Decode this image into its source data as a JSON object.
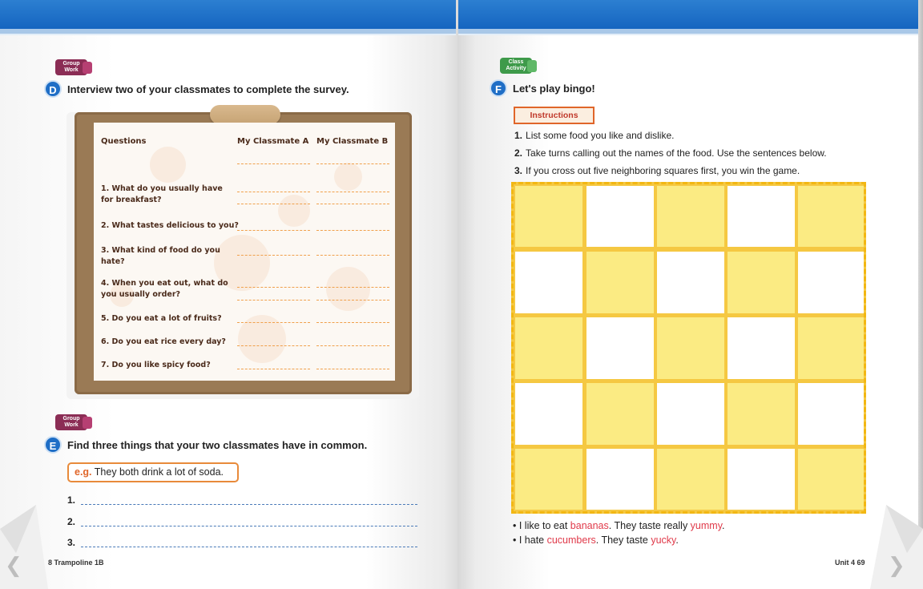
{
  "left_page": {
    "section_d": {
      "badge": "Group\nWork",
      "letter": "D",
      "title": "Interview two of your classmates to complete the survey.",
      "table": {
        "col_questions": "Questions",
        "col_a": "My Classmate A",
        "col_b": "My Classmate B",
        "questions": [
          "1. What do you usually have for breakfast?",
          "2. What tastes delicious to you?",
          "3. What kind of food do you hate?",
          "4. When you eat out, what do you usually order?",
          "5. Do you eat a lot of fruits?",
          "6. Do you eat rice every day?",
          "7. Do you like spicy food?"
        ]
      }
    },
    "section_e": {
      "badge": "Group\nWork",
      "letter": "E",
      "title": "Find three things that your two classmates have in common.",
      "example_prefix": "e.g.",
      "example_text": "They both drink a lot of soda.",
      "lines": [
        "1.",
        "2.",
        "3."
      ]
    },
    "footer": "8 Trampoline 1B"
  },
  "right_page": {
    "section_f": {
      "badge": "Class\nActivity",
      "letter": "F",
      "title": "Let's play bingo!",
      "instructions_label": "Instructions",
      "instructions": [
        {
          "n": "1.",
          "text": "List some food you like and dislike."
        },
        {
          "n": "2.",
          "text": "Take turns calling out the names of the food. Use the sentences below."
        },
        {
          "n": "3.",
          "text": "If you cross out five neighboring squares first, you win the game."
        }
      ],
      "sentences": [
        {
          "pre": "I like to eat ",
          "food": "bananas",
          "mid": ". They taste really ",
          "taste": "yummy",
          "post": "."
        },
        {
          "pre": "I hate ",
          "food": "cucumbers",
          "mid": ". They taste ",
          "taste": "yucky",
          "post": "."
        }
      ]
    },
    "footer": "Unit 4 69"
  },
  "colors": {
    "header_blue": "#1565c0",
    "section_circle": "#1f6ec6",
    "bingo_yellow": "#fbeb83",
    "bingo_border": "#f2b713",
    "highlight_red": "#e03a4a"
  }
}
